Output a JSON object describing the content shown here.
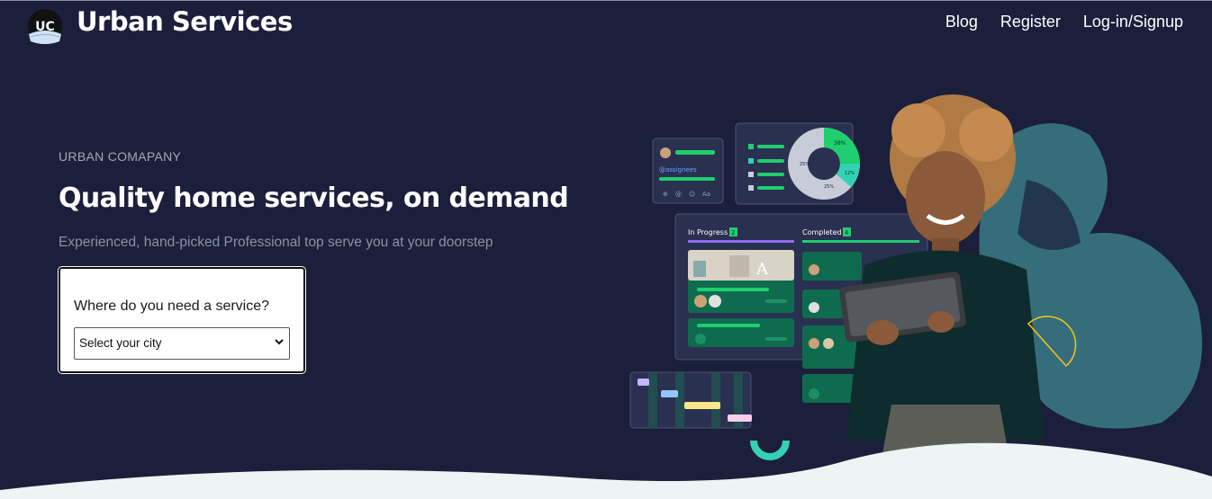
{
  "header": {
    "brand": "Urban Services",
    "logo_text": "UC",
    "nav": [
      "Blog",
      "Register",
      "Log-in/Signup"
    ]
  },
  "hero": {
    "eyebrow": "URBAN COMAPANY",
    "title": "Quality home services, on demand",
    "subtitle": "Experienced, hand-picked Professional top serve you at your doorstep"
  },
  "search_card": {
    "label": "Where do you need a service?",
    "select_value": "Select your city"
  },
  "illustration": {
    "assignees_label": "@assignees",
    "format_label": "Aa",
    "columns": [
      {
        "label": "In Progress",
        "count": "2"
      },
      {
        "label": "Completed",
        "count": "4"
      }
    ],
    "donut_labels": [
      "38%",
      "12%",
      "25%",
      "25%"
    ]
  },
  "colors": {
    "background": "#1b1f3b",
    "accent_green": "#1fce6e",
    "accent_teal": "#35d1b4",
    "card_green": "#0f6b4e",
    "wave": "#eef4f3"
  }
}
